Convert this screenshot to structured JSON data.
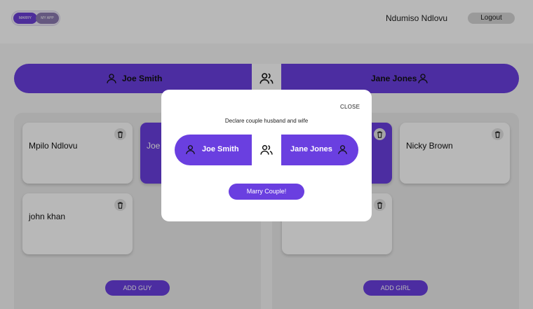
{
  "header": {
    "logo_left": "MARRY",
    "logo_right": "MY APP",
    "user_name": "Ndumiso Ndlovu",
    "logout_label": "Logout"
  },
  "selection": {
    "groom": "Joe Smith",
    "bride": "Jane Jones"
  },
  "guys": {
    "cards": [
      "Mpilo Ndlovu",
      "Joe",
      "john khan"
    ],
    "add_label": "ADD GUY"
  },
  "girls": {
    "cards": [
      "",
      "Nicky Brown",
      ""
    ],
    "add_label": "ADD GIRL"
  },
  "modal": {
    "close_label": "CLOSE",
    "title": "Declare couple husband and wife",
    "groom": "Joe Smith",
    "bride": "Jane Jones",
    "marry_label": "Marry Couple!"
  },
  "colors": {
    "accent": "#6a3fe0",
    "overlay": "rgba(0,0,0,0.28)"
  },
  "icons": {
    "person": "person-icon",
    "couple": "couple-icon",
    "trash": "trash-icon"
  }
}
